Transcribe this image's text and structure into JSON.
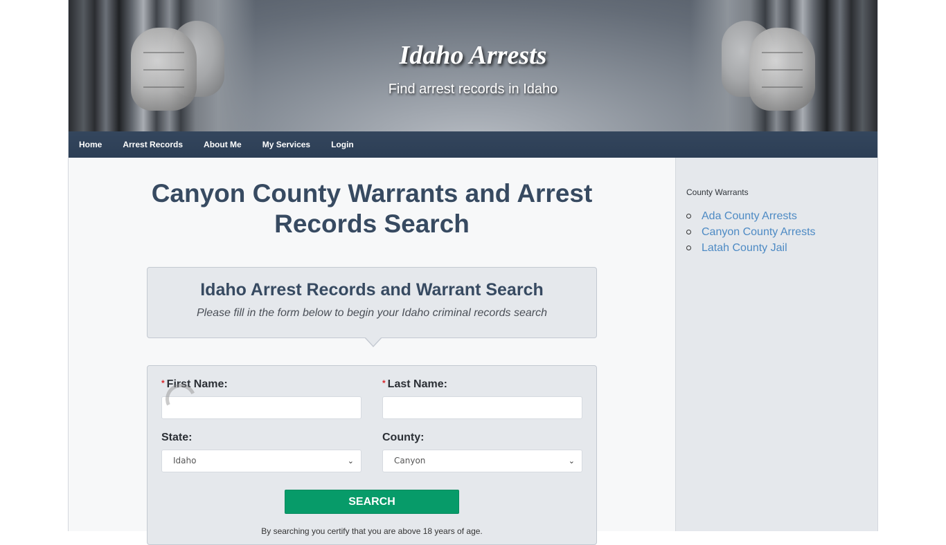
{
  "header": {
    "site_title": "Idaho Arrests",
    "tagline": "Find arrest records in Idaho"
  },
  "nav": {
    "items": [
      {
        "label": "Home"
      },
      {
        "label": "Arrest Records"
      },
      {
        "label": "About Me"
      },
      {
        "label": "My Services"
      },
      {
        "label": "Login"
      }
    ]
  },
  "main": {
    "page_title": "Canyon County Warrants and Arrest Records Search",
    "intro": {
      "heading": "Idaho Arrest Records and Warrant Search",
      "subtext": "Please fill in the form below to begin your Idaho criminal records search"
    },
    "form": {
      "required_marker": "*",
      "first_name_label": "First Name:",
      "first_name_value": "",
      "last_name_label": "Last Name:",
      "last_name_value": "",
      "state_label": "State:",
      "state_selected": "Idaho",
      "county_label": "County:",
      "county_selected": "Canyon",
      "search_label": "SEARCH",
      "disclaimer": "By searching you certify that you are above 18 years of age."
    }
  },
  "sidebar": {
    "title": "County Warrants",
    "links": [
      {
        "label": "Ada County Arrests"
      },
      {
        "label": "Canyon County Arrests"
      },
      {
        "label": "Latah County Jail"
      }
    ]
  },
  "colors": {
    "nav_bg": "#2c3e55",
    "title_text": "#374a61",
    "search_button": "#079b69",
    "link": "#4d8ac4",
    "required": "#d9262b"
  }
}
